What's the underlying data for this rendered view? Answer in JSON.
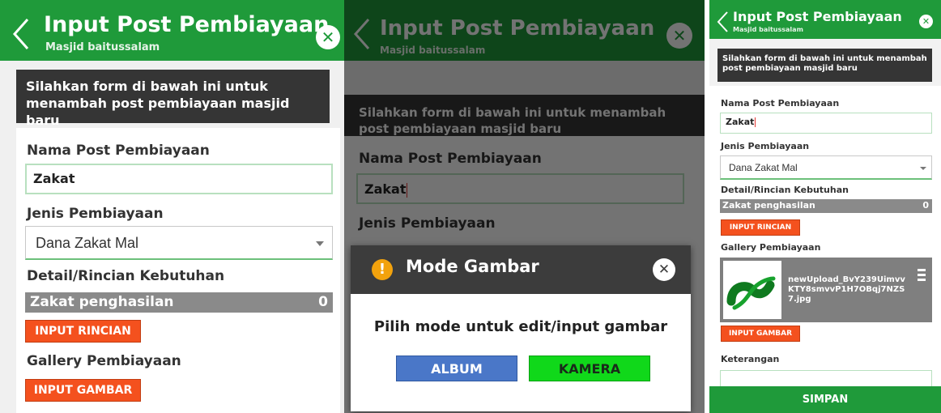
{
  "header": {
    "title": "Input Post Pembiayaan",
    "subtitle": "Masjid baitussalam",
    "back_icon": "chevron-left-icon",
    "close_icon": "close-icon"
  },
  "info_text": "Silahkan form di bawah ini untuk menambah post pembiayaan masjid baru",
  "form": {
    "name_label": "Nama Post Pembiayaan",
    "name_value": "Zakat",
    "type_label": "Jenis Pembiayaan",
    "type_value": "Dana Zakat Mal",
    "detail_label": "Detail/Rincian Kebutuhan",
    "detail_item": "Zakat penghasilan",
    "detail_amount": "0",
    "input_rincian": "INPUT RINCIAN",
    "gallery_label": "Gallery Pembiayaan",
    "input_gambar": "INPUT GAMBAR",
    "gallery_file": "newUpload_BvY239UimvvKTY8smvvP1H7OBqj7NZS7.jpg",
    "keterangan_label": "Keterangan",
    "save": "SIMPAN"
  },
  "dialog": {
    "title": "Mode Gambar",
    "message": "Pilih mode untuk edit/input gambar",
    "album": "ALBUM",
    "kamera": "KAMERA",
    "warning_icon": "warning-icon",
    "close_icon": "close-icon"
  },
  "colors": {
    "header_green": "#1f9a3a",
    "button_orange": "#f4511e",
    "album_blue": "#4a77c8",
    "kamera_green": "#10d81a"
  }
}
